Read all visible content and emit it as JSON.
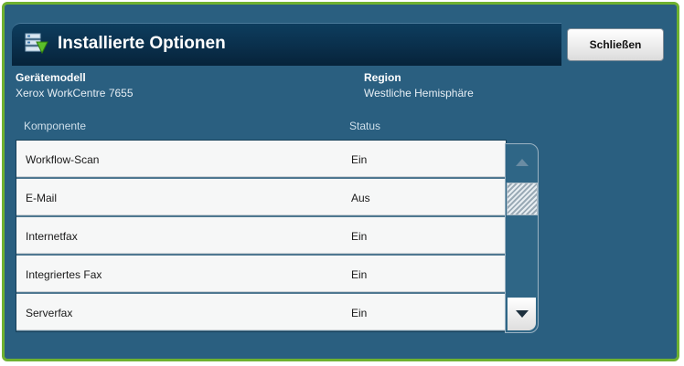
{
  "window": {
    "title": "Installierte Optionen",
    "title_icon": "installed-options-icon",
    "close_label": "Schließen"
  },
  "device": {
    "model_label": "Gerätemodell",
    "model_value": "Xerox WorkCentre 7655",
    "region_label": "Region",
    "region_value": "Westliche Hemisphäre"
  },
  "table": {
    "columns": [
      "Komponente",
      "Status"
    ],
    "rows": [
      {
        "component": "Workflow-Scan",
        "status": "Ein"
      },
      {
        "component": "E-Mail",
        "status": "Aus"
      },
      {
        "component": "Internetfax",
        "status": "Ein"
      },
      {
        "component": "Integriertes Fax",
        "status": "Ein"
      },
      {
        "component": "Serverfax",
        "status": "Ein"
      }
    ]
  },
  "scrollbar": {
    "up_icon": "scroll-up-arrow-icon",
    "down_icon": "scroll-down-arrow-icon"
  },
  "colors": {
    "background": "#2a5f80",
    "border": "#6fb130",
    "titlebar": "#0a2f4b"
  }
}
